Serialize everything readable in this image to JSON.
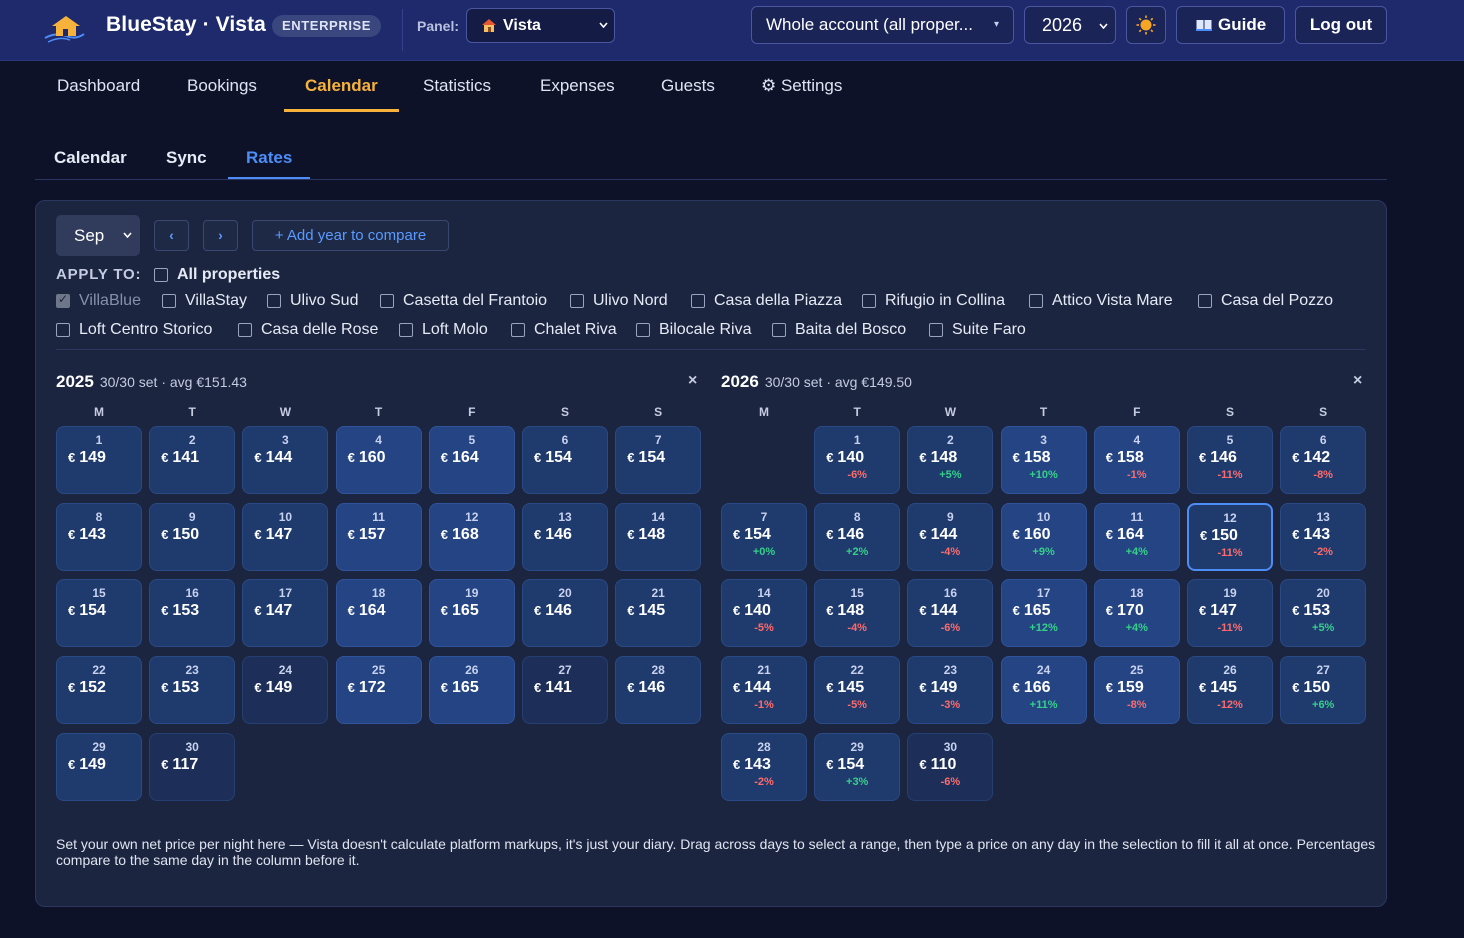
{
  "header": {
    "brand": "BlueStay · Vista",
    "edition_badge": "ENTERPRISE",
    "panel_label": "Panel:",
    "panel_value": "Vista",
    "account_value": "Whole account (all proper...",
    "year_value": "2026",
    "guide_label": "Guide",
    "logout_label": "Log out",
    "accent_color": "#f6b23b",
    "topbar_color": "#1e2a6b"
  },
  "nav": {
    "tabs": [
      "Dashboard",
      "Bookings",
      "Calendar",
      "Statistics",
      "Expenses",
      "Guests",
      "⚙ Settings"
    ],
    "active": "Calendar"
  },
  "subnav": {
    "tabs": [
      "Calendar",
      "Sync",
      "Rates"
    ],
    "active": "Rates"
  },
  "controls": {
    "month_value": "Sep",
    "prev_label": "‹",
    "next_label": "›",
    "add_year_label": "+ Add year to compare"
  },
  "apply_to": {
    "label": "APPLY TO:",
    "all_label": "All properties",
    "properties": [
      {
        "name": "VillaBlue",
        "checked": true,
        "disabled": true
      },
      {
        "name": "VillaStay",
        "checked": false
      },
      {
        "name": "Ulivo Sud",
        "checked": false
      },
      {
        "name": "Casetta del Frantoio",
        "checked": false
      },
      {
        "name": "Ulivo Nord",
        "checked": false
      },
      {
        "name": "Casa della Piazza",
        "checked": false
      },
      {
        "name": "Rifugio in Collina",
        "checked": false
      },
      {
        "name": "Attico Vista Mare",
        "checked": false
      },
      {
        "name": "Casa del Pozzo",
        "checked": false
      },
      {
        "name": "Loft Centro Storico",
        "checked": false
      },
      {
        "name": "Casa delle Rose",
        "checked": false
      },
      {
        "name": "Loft Molo",
        "checked": false
      },
      {
        "name": "Chalet Riva",
        "checked": false
      },
      {
        "name": "Bilocale Riva",
        "checked": false
      },
      {
        "name": "Baita del Bosco",
        "checked": false
      },
      {
        "name": "Suite Faro",
        "checked": false
      }
    ]
  },
  "weekdays": [
    "M",
    "T",
    "W",
    "T",
    "F",
    "S",
    "S"
  ],
  "currency": "€",
  "calendars": [
    {
      "year": "2025",
      "summary": "30/30 set · avg €151.43",
      "close": "×",
      "first_weekday": 0,
      "days": [
        {
          "d": "1",
          "p": "149"
        },
        {
          "d": "2",
          "p": "141"
        },
        {
          "d": "3",
          "p": "144"
        },
        {
          "d": "4",
          "p": "160"
        },
        {
          "d": "5",
          "p": "164"
        },
        {
          "d": "6",
          "p": "154"
        },
        {
          "d": "7",
          "p": "154"
        },
        {
          "d": "8",
          "p": "143"
        },
        {
          "d": "9",
          "p": "150"
        },
        {
          "d": "10",
          "p": "147"
        },
        {
          "d": "11",
          "p": "157"
        },
        {
          "d": "12",
          "p": "168"
        },
        {
          "d": "13",
          "p": "146"
        },
        {
          "d": "14",
          "p": "148"
        },
        {
          "d": "15",
          "p": "154"
        },
        {
          "d": "16",
          "p": "153"
        },
        {
          "d": "17",
          "p": "147"
        },
        {
          "d": "18",
          "p": "164"
        },
        {
          "d": "19",
          "p": "165"
        },
        {
          "d": "20",
          "p": "146"
        },
        {
          "d": "21",
          "p": "145"
        },
        {
          "d": "22",
          "p": "152"
        },
        {
          "d": "23",
          "p": "153"
        },
        {
          "d": "24",
          "p": "149"
        },
        {
          "d": "25",
          "p": "172"
        },
        {
          "d": "26",
          "p": "165"
        },
        {
          "d": "27",
          "p": "141"
        },
        {
          "d": "28",
          "p": "146"
        },
        {
          "d": "29",
          "p": "149"
        },
        {
          "d": "30",
          "p": "117"
        }
      ]
    },
    {
      "year": "2026",
      "summary": "30/30 set · avg €149.50",
      "close": "×",
      "first_weekday": 1,
      "selected_day": "12",
      "days": [
        {
          "d": "1",
          "p": "140",
          "c": "-6%"
        },
        {
          "d": "2",
          "p": "148",
          "c": "+5%"
        },
        {
          "d": "3",
          "p": "158",
          "c": "+10%"
        },
        {
          "d": "4",
          "p": "158",
          "c": "-1%"
        },
        {
          "d": "5",
          "p": "146",
          "c": "-11%"
        },
        {
          "d": "6",
          "p": "142",
          "c": "-8%"
        },
        {
          "d": "7",
          "p": "154",
          "c": "+0%"
        },
        {
          "d": "8",
          "p": "146",
          "c": "+2%"
        },
        {
          "d": "9",
          "p": "144",
          "c": "-4%"
        },
        {
          "d": "10",
          "p": "160",
          "c": "+9%"
        },
        {
          "d": "11",
          "p": "164",
          "c": "+4%"
        },
        {
          "d": "12",
          "p": "150",
          "c": "-11%"
        },
        {
          "d": "13",
          "p": "143",
          "c": "-2%"
        },
        {
          "d": "14",
          "p": "140",
          "c": "-5%"
        },
        {
          "d": "15",
          "p": "148",
          "c": "-4%"
        },
        {
          "d": "16",
          "p": "144",
          "c": "-6%"
        },
        {
          "d": "17",
          "p": "165",
          "c": "+12%"
        },
        {
          "d": "18",
          "p": "170",
          "c": "+4%"
        },
        {
          "d": "19",
          "p": "147",
          "c": "-11%"
        },
        {
          "d": "20",
          "p": "153",
          "c": "+5%"
        },
        {
          "d": "21",
          "p": "144",
          "c": "-1%"
        },
        {
          "d": "22",
          "p": "145",
          "c": "-5%"
        },
        {
          "d": "23",
          "p": "149",
          "c": "-3%"
        },
        {
          "d": "24",
          "p": "166",
          "c": "+11%"
        },
        {
          "d": "25",
          "p": "159",
          "c": "-8%"
        },
        {
          "d": "26",
          "p": "145",
          "c": "-12%"
        },
        {
          "d": "27",
          "p": "150",
          "c": "+6%"
        },
        {
          "d": "28",
          "p": "143",
          "c": "-2%"
        },
        {
          "d": "29",
          "p": "154",
          "c": "+3%"
        },
        {
          "d": "30",
          "p": "110",
          "c": "-6%"
        }
      ]
    }
  ],
  "note": "Set your own net price per night here — Vista doesn't calculate platform markups, it's just your diary. Drag across days to select a range, then type a price on any day in the selection to fill it all at once. Percentages compare to the same day in the column before it."
}
